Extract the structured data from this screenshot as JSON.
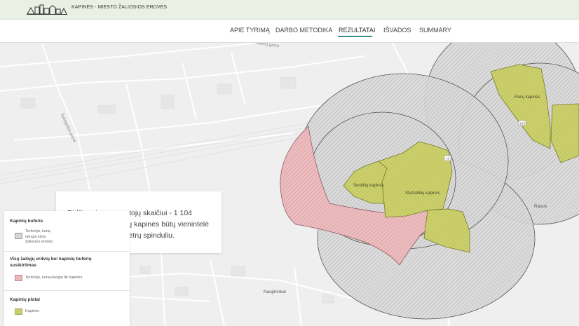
{
  "header": {
    "app_title": "KAPINĖS - MIESTO ŽALIOSIOS ERDVĖS",
    "logo": "city-skyline-logo"
  },
  "nav": {
    "items": [
      {
        "label": "APIE TYRIMĄ",
        "active": false
      },
      {
        "label": "DARBO METODIKA",
        "active": false
      },
      {
        "label": "REZULTATAI",
        "active": true
      },
      {
        "label": "IŠVADOS",
        "active": false
      },
      {
        "label": "SUMMARY",
        "active": false
      }
    ]
  },
  "map": {
    "streets": [
      "Šeimų gatvė",
      "Švitrigailos gatvė"
    ],
    "road_shields": [
      "103",
      "A3"
    ],
    "cemeteries": [
      "Rasų kapinės",
      "Sentikių kapinės",
      "Stačiatikių kapinės"
    ],
    "places": [
      "Rasos",
      "Naujininkai"
    ]
  },
  "stat_card": {
    "text": "Didžiausiam gyventojų skaičiui - 1 104 žmonėms - Sentikių kapinės būtų vienintelė žalioji erdvė 300 metrų spinduliu."
  },
  "legend": {
    "sections": [
      {
        "title": "Kapinių buferis",
        "item": "Teritorija, kurią dengia kitos žaliosios erdvės"
      },
      {
        "title": "Visų žaliųjų erdvių bei kapinių buferių susikirtimas",
        "item": "Teritorija, kurią dengia tik kapinės"
      },
      {
        "title": "Kapinių plotai",
        "item": "Kapinės"
      }
    ],
    "colors": {
      "buffer_grey": "#bdbdbd",
      "only_cemetery_pink": "#e8a9ad",
      "cemetery_olive": "#c9cf6a"
    }
  }
}
